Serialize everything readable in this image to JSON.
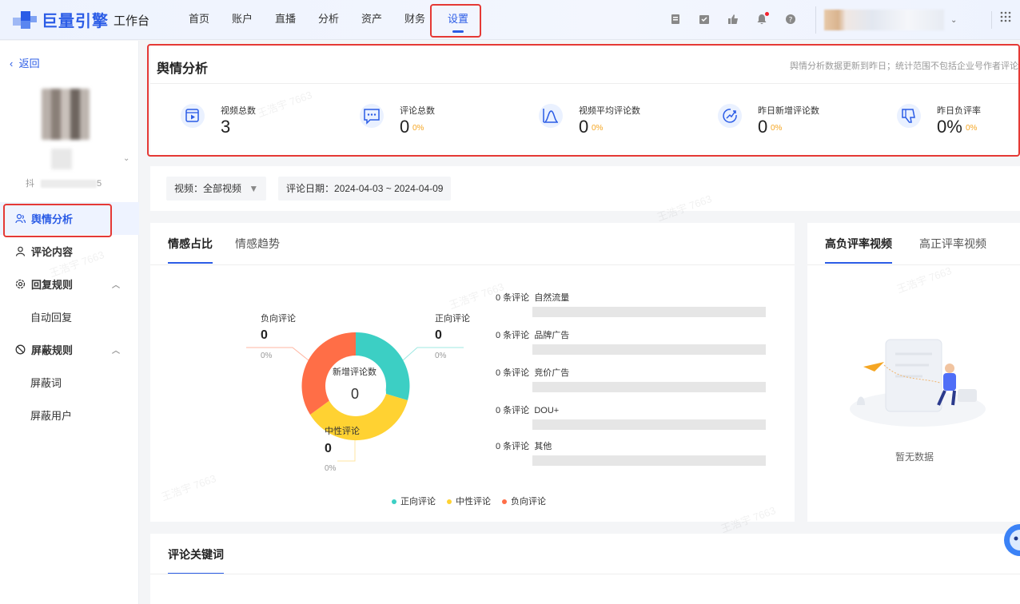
{
  "brand": {
    "name": "巨量引擎",
    "workbench": "工作台",
    "accent": "#2b5ce6"
  },
  "nav": [
    {
      "label": "首页"
    },
    {
      "label": "账户"
    },
    {
      "label": "直播"
    },
    {
      "label": "分析"
    },
    {
      "label": "资产"
    },
    {
      "label": "财务"
    },
    {
      "label": "设置",
      "active": true
    }
  ],
  "top_icons": [
    "document-icon",
    "clipboard-icon",
    "thumbs-up-icon",
    "bell-icon",
    "help-icon"
  ],
  "sidebar": {
    "back": "返回",
    "account_id_prefix": "抖",
    "account_id_suffix": "5",
    "menu": [
      {
        "label": "舆情分析",
        "icon": "people-icon",
        "active": true
      },
      {
        "label": "评论内容",
        "icon": "user-icon"
      },
      {
        "label": "回复规则",
        "icon": "gear-icon",
        "expanded": true
      },
      {
        "label": "自动回复",
        "sub": true
      },
      {
        "label": "屏蔽规则",
        "icon": "block-icon",
        "expanded": true
      },
      {
        "label": "屏蔽词",
        "sub": true
      },
      {
        "label": "屏蔽用户",
        "sub": true
      }
    ]
  },
  "overview": {
    "title": "舆情分析",
    "note": "舆情分析数据更新到昨日；统计范围不包括企业号作者评论",
    "stats": [
      {
        "label": "视频总数",
        "value": "3",
        "pct": "",
        "icon": "video-icon"
      },
      {
        "label": "评论总数",
        "value": "0",
        "pct": "0%",
        "icon": "comment-icon"
      },
      {
        "label": "视频平均评论数",
        "value": "0",
        "pct": "0%",
        "icon": "chart-curve-icon"
      },
      {
        "label": "昨日新增评论数",
        "value": "0",
        "pct": "0%",
        "icon": "growth-icon"
      },
      {
        "label": "昨日负评率",
        "value": "0%",
        "pct": "0%",
        "icon": "thumbs-down-icon"
      }
    ]
  },
  "filters": {
    "video_label": "视频：全部视频",
    "date_label": "评论日期：",
    "date_range": "2024-04-03 ~ 2024-04-09"
  },
  "emotion": {
    "tabs": [
      "情感占比",
      "情感趋势"
    ],
    "donut_center_label": "新增评论数",
    "donut_center_value": "0",
    "negative": {
      "label": "负向评论",
      "value": "0",
      "pct": "0%",
      "color": "#ff6e47"
    },
    "positive": {
      "label": "正向评论",
      "value": "0",
      "pct": "0%",
      "color": "#3ccfc4"
    },
    "neutral": {
      "label": "中性评论",
      "value": "0",
      "pct": "0%",
      "color": "#ffd232"
    },
    "sources": [
      {
        "count": "0 条评论",
        "name": "自然流量"
      },
      {
        "count": "0 条评论",
        "name": "品牌广告"
      },
      {
        "count": "0 条评论",
        "name": "竞价广告"
      },
      {
        "count": "0 条评论",
        "name": "DOU+"
      },
      {
        "count": "0 条评论",
        "name": "其他"
      }
    ],
    "legend": [
      "正向评论",
      "中性评论",
      "负向评论"
    ]
  },
  "videos": {
    "tabs": [
      "高负评率视频",
      "高正评率视频"
    ],
    "empty": "暂无数据"
  },
  "keywords": {
    "title": "评论关键词"
  },
  "watermark": "王浩宇 7663"
}
